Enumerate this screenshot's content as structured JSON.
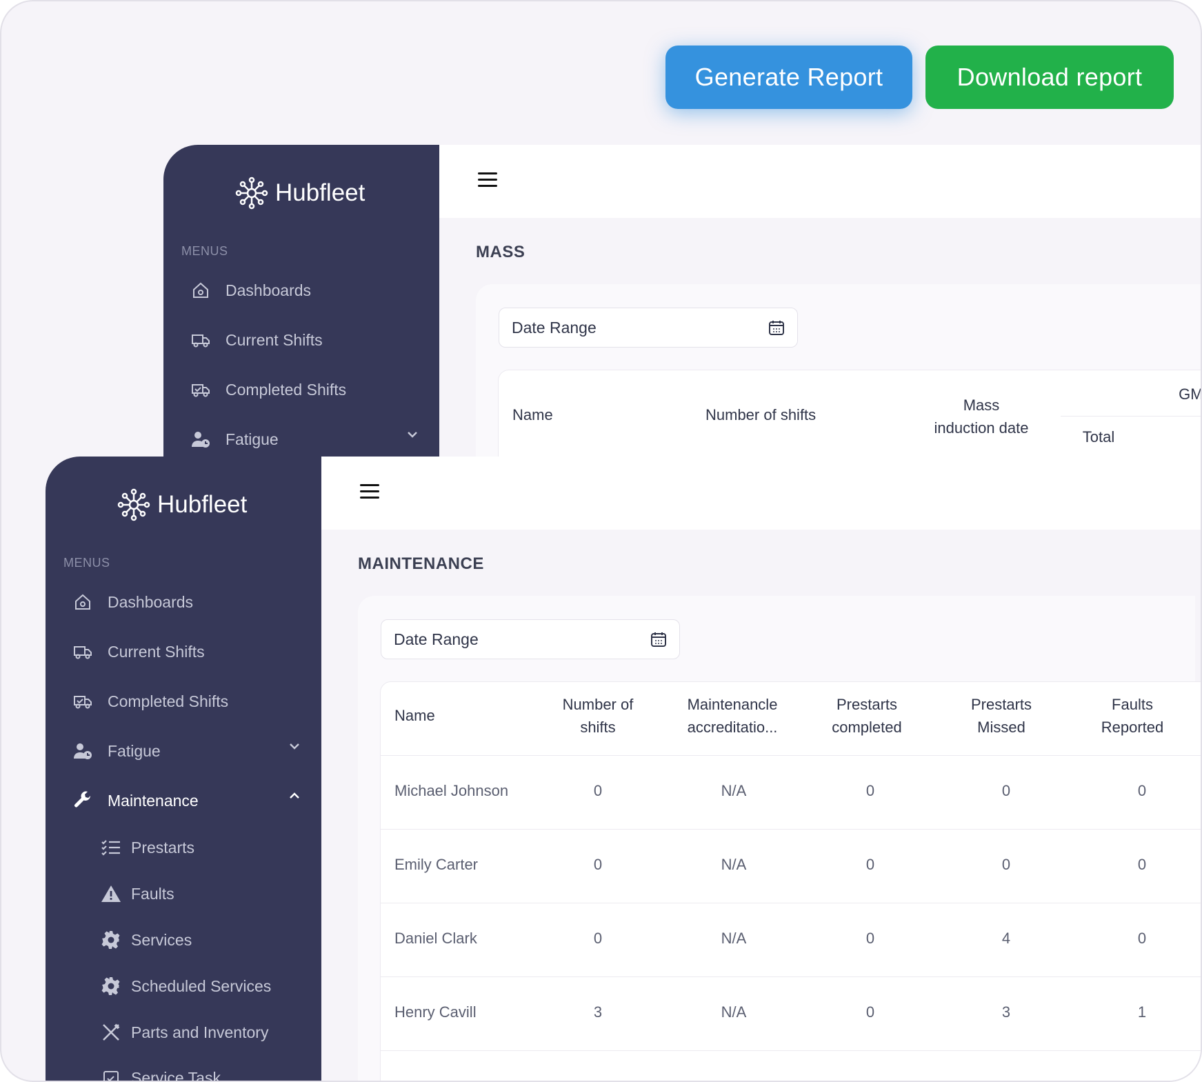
{
  "actions": {
    "generate": "Generate Report",
    "download": "Download report"
  },
  "brand": "Hubfleet",
  "menus_label": "MENUS",
  "nav": {
    "dashboards": "Dashboards",
    "current_shifts": "Current Shifts",
    "completed_shifts": "Completed Shifts",
    "fatigue": "Fatigue",
    "maintenance": "Maintenance"
  },
  "maintenance_sub": {
    "prestarts": "Prestarts",
    "faults": "Faults",
    "services": "Services",
    "scheduled_services": "Scheduled Services",
    "parts_inventory": "Parts and Inventory",
    "service_task": "Service Task"
  },
  "mass": {
    "title": "MASS",
    "date_range": "Date Range",
    "headers": {
      "name": "Name",
      "shifts": "Number of shifts",
      "induction_line1": "Mass",
      "induction_line2": "induction date",
      "gml": "GML",
      "total": "Total"
    }
  },
  "maintenance": {
    "title": "MAINTENANCE",
    "date_range": "Date Range",
    "headers": {
      "name": "Name",
      "shifts_line1": "Number of",
      "shifts_line2": "shifts",
      "accr_line1": "Maintenancle",
      "accr_line2": "accreditatio...",
      "completed_line1": "Prestarts",
      "completed_line2": "completed",
      "missed_line1": "Prestarts",
      "missed_line2": "Missed",
      "faults_line1": "Faults",
      "faults_line2": "Reported"
    },
    "rows": [
      {
        "name": "Michael Johnson",
        "shifts": "0",
        "accreditation": "N/A",
        "completed": "0",
        "missed": "0",
        "faults": "0"
      },
      {
        "name": "Emily Carter",
        "shifts": "0",
        "accreditation": "N/A",
        "completed": "0",
        "missed": "0",
        "faults": "0"
      },
      {
        "name": "Daniel Clark",
        "shifts": "0",
        "accreditation": "N/A",
        "completed": "0",
        "missed": "4",
        "faults": "0"
      },
      {
        "name": "Henry Cavill",
        "shifts": "3",
        "accreditation": "N/A",
        "completed": "0",
        "missed": "3",
        "faults": "1"
      }
    ]
  }
}
